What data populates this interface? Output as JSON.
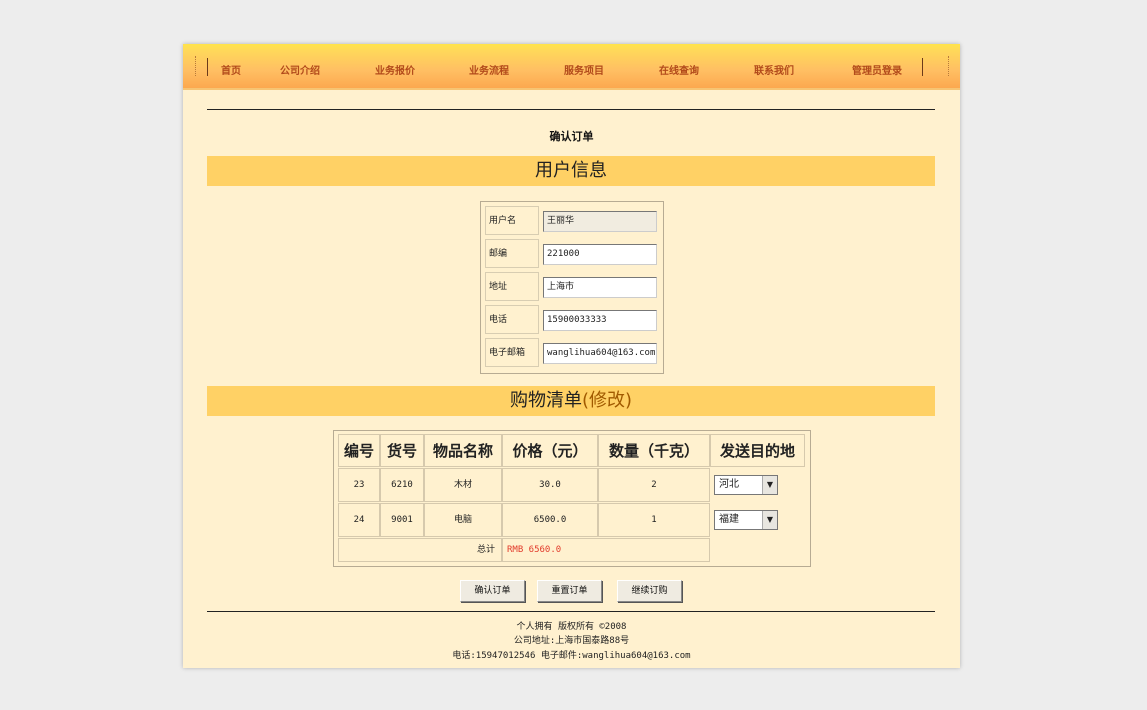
{
  "nav": {
    "items": [
      "首页",
      "公司介绍",
      "业务报价",
      "业务流程",
      "服务项目",
      "在线查询",
      "联系我们",
      "管理员登录"
    ]
  },
  "order": {
    "title": "确认订单"
  },
  "user_info": {
    "heading": "用户信息",
    "fields": [
      {
        "label": "用户名",
        "value": "王丽华"
      },
      {
        "label": "邮编",
        "value": "221000"
      },
      {
        "label": "地址",
        "value": "上海市"
      },
      {
        "label": "电话",
        "value": "15900033333"
      },
      {
        "label": "电子邮箱",
        "value": "wanglihua604@163.com"
      }
    ]
  },
  "cart": {
    "heading": "购物清单",
    "modify_link": "(修改)",
    "columns": [
      "编号",
      "货号",
      "物品名称",
      "价格（元）",
      "数量（千克）",
      "发送目的地"
    ],
    "rows": [
      {
        "id": "23",
        "sku": "6210",
        "name": "木材",
        "price": "30.0",
        "qty": "2",
        "dest": "河北"
      },
      {
        "id": "24",
        "sku": "9001",
        "name": "电脑",
        "price": "6500.0",
        "qty": "1",
        "dest": "福建"
      }
    ],
    "total_label": "总计",
    "total_value": "RMB 6560.0"
  },
  "buttons": {
    "confirm": "确认订单",
    "reset": "重置订单",
    "continue": "继续订购"
  },
  "footer": {
    "line1": "个人拥有 版权所有 ©2008",
    "line2": "公司地址:上海市国泰路88号",
    "line3": "电话:15947012546 电子邮件:wanglihua604@163.com"
  },
  "colors": {
    "nav_text": "#b24a1b",
    "section_bar": "#ffd165",
    "total": "#e23b2b",
    "page_bg": "#fff1cf"
  }
}
